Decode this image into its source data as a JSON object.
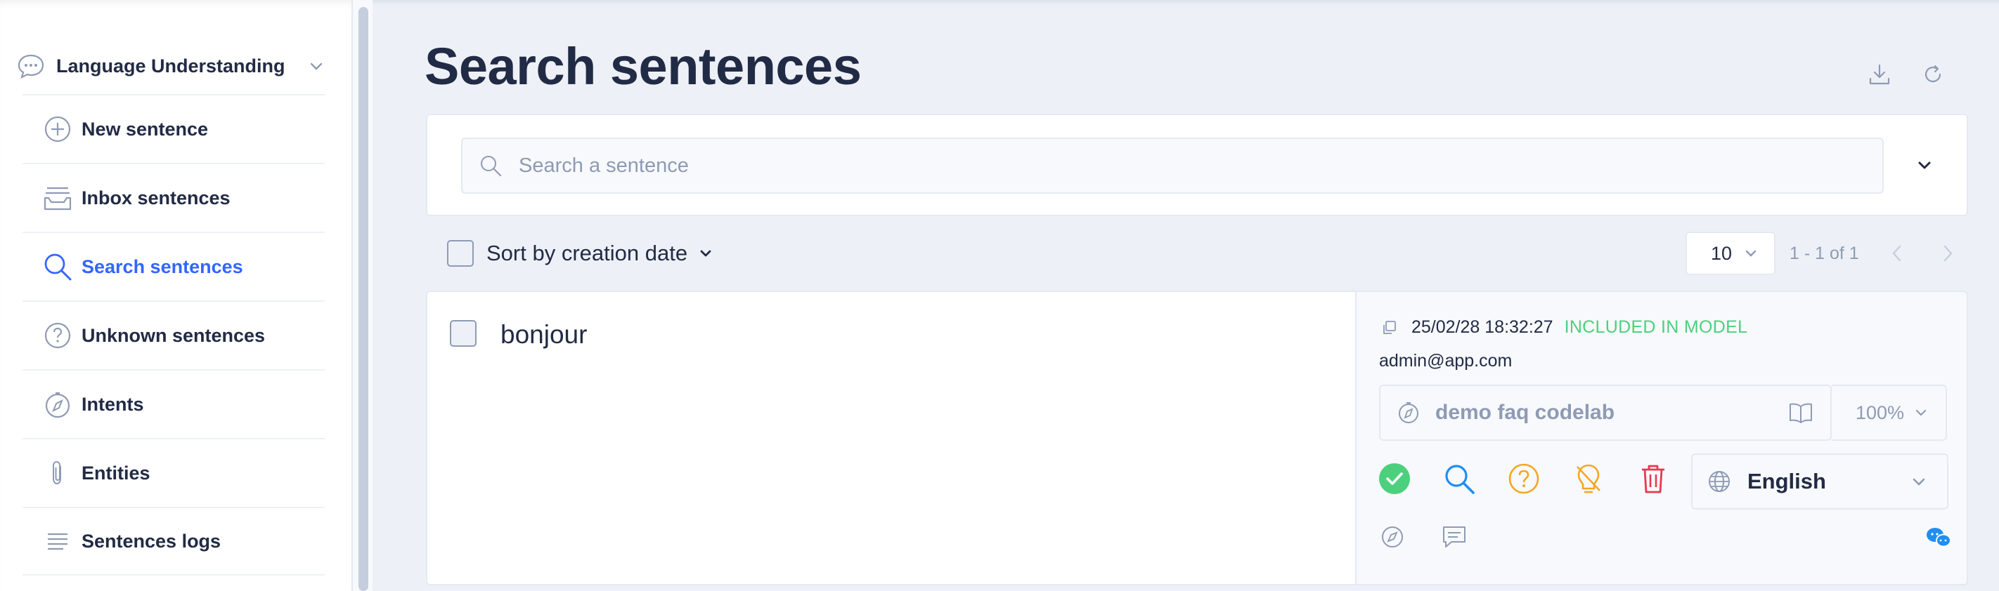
{
  "sidebar": {
    "section_label": "Language Understanding",
    "items": [
      {
        "label": "New sentence",
        "icon": "plus-circle-icon",
        "active": false
      },
      {
        "label": "Inbox sentences",
        "icon": "inbox-icon",
        "active": false
      },
      {
        "label": "Search sentences",
        "icon": "search-icon",
        "active": true
      },
      {
        "label": "Unknown sentences",
        "icon": "question-circle-icon",
        "active": false
      },
      {
        "label": "Intents",
        "icon": "compass-icon",
        "active": false
      },
      {
        "label": "Entities",
        "icon": "paperclip-icon",
        "active": false
      },
      {
        "label": "Sentences logs",
        "icon": "list-icon",
        "active": false
      }
    ]
  },
  "header": {
    "title": "Search sentences"
  },
  "search": {
    "placeholder": "Search a sentence",
    "value": ""
  },
  "sort": {
    "label": "Sort by creation date"
  },
  "pagination": {
    "page_size": "10",
    "range": "1 - 1 of 1"
  },
  "sentence": {
    "text": "bonjour",
    "date": "25/02/28 18:32:27",
    "status": "INCLUDED IN MODEL",
    "author": "admin@app.com",
    "intent": "demo faq codelab",
    "confidence": "100%",
    "language": "English"
  },
  "colors": {
    "accent": "#3366ff",
    "text": "#222b45",
    "muted": "#8f9bb3",
    "success": "#4cd07d",
    "warning": "#f5a623",
    "danger": "#e8384f",
    "info": "#1f8ef1"
  }
}
